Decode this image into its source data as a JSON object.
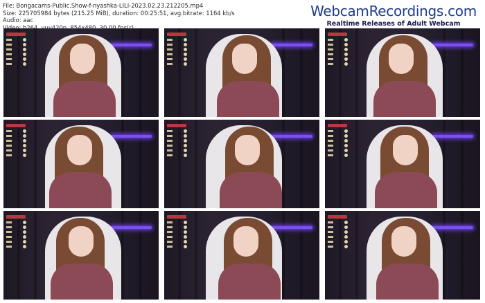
{
  "file_info": {
    "file_line": "File: Bongacams-Public.Show-f-nyashka-LILI-2023.02.23.212205.mp4",
    "size_line": "Size: 225705984 bytes (215.25 MiB), duration: 00:25:51, avg.bitrate: 1164 kb/s",
    "audio_line": "Audio: aac",
    "video_line": "Video: h264, yuv420p, 854x480, 30.00 fps(r)"
  },
  "brand": {
    "name": "WebcamRecordings.com",
    "tagline": "Realtime Releases of Adult Webcam Recordings"
  },
  "thumbnails": [
    {
      "id": 1
    },
    {
      "id": 2
    },
    {
      "id": 3
    },
    {
      "id": 4
    },
    {
      "id": 5
    },
    {
      "id": 6
    },
    {
      "id": 7
    },
    {
      "id": 8
    },
    {
      "id": 9
    }
  ],
  "colors": {
    "brand_blue": "#1d3b8f",
    "neon_purple": "#7b4ff0",
    "top_purple": "#8b4a55"
  }
}
